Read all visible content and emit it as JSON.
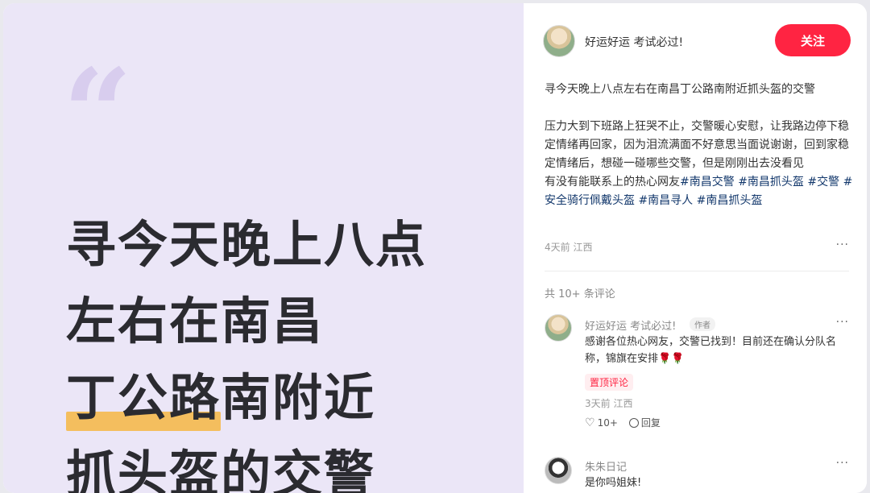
{
  "cover": {
    "quote_mark": "“",
    "lines": [
      "寻今天晚上八点",
      "左右在南昌",
      "南附近",
      "抓头盔的交警"
    ],
    "highlight": "丁公路"
  },
  "author": {
    "name": "好运好运 考试必过!",
    "follow_label": "关注"
  },
  "post": {
    "title": "寻今天晚上八点左右在南昌丁公路南附近抓头盔的交警",
    "body": "压力大到下班路上狂哭不止，交警暖心安慰，让我路边停下稳定情绪再回家，因为泪流满面不好意思当面说谢谢，回到家稳定情绪后，想碰一碰哪些交警，但是刚刚出去没看见",
    "body2": "有没有能联系上的热心网友",
    "tags": [
      "#南昌交警",
      "#南昌抓头盔",
      "#交警",
      "#安全骑行佩戴头盔",
      "#南昌寻人",
      "#南昌抓头盔"
    ],
    "meta": "4天前 江西"
  },
  "more_label": "···",
  "comments_count": "共 10+ 条评论",
  "comments": [
    {
      "name": "好运好运 考试必过!",
      "author_tag": "作者",
      "text": "感谢各位热心网友，交警已找到！目前还在确认分队名称，锦旗在安排🌹🌹",
      "pin": "置顶评论",
      "meta": "3天前 江西",
      "likes": "10+",
      "reply_label": "回复"
    },
    {
      "name": "朱朱日记",
      "text": "是你吗姐妹!"
    }
  ],
  "colors": {
    "accent": "#ff2442",
    "cover_bg": "#ebe6f7",
    "highlight": "#f4be5e",
    "tag": "#13386c"
  }
}
